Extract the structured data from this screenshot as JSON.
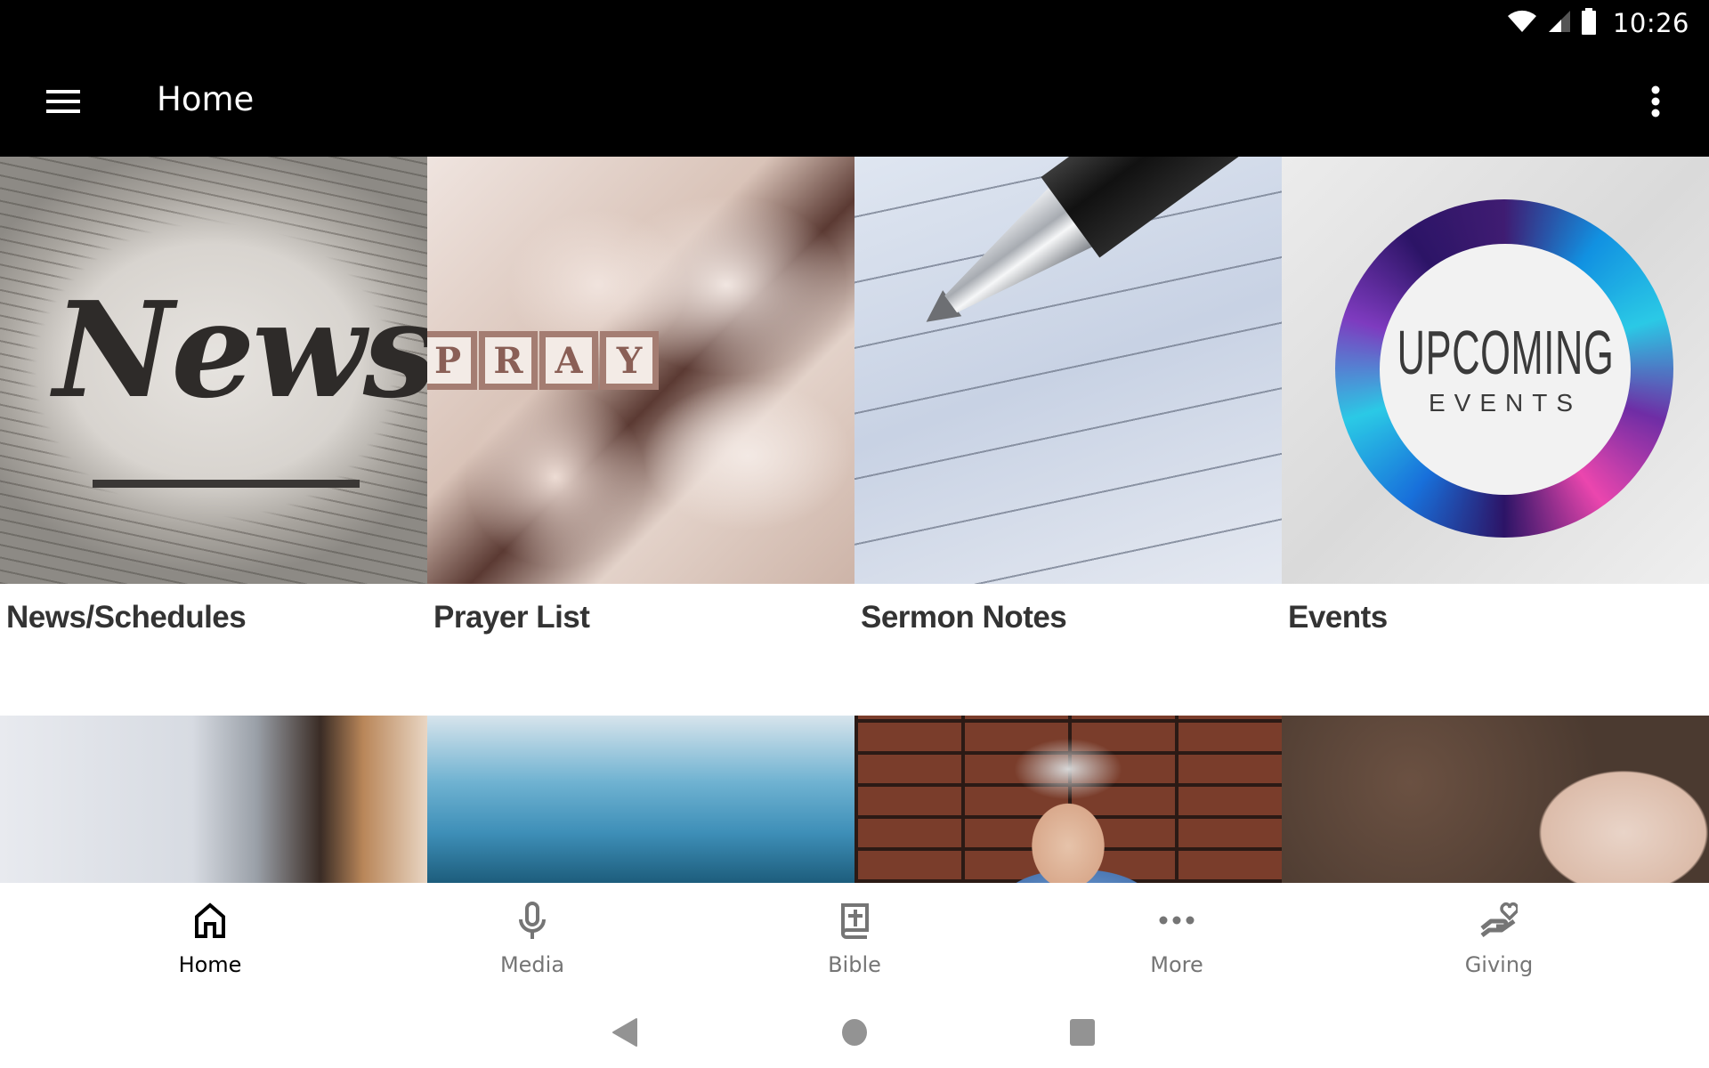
{
  "status_bar": {
    "time": "10:26",
    "icons": [
      "wifi-icon",
      "cell-signal-icon",
      "battery-icon"
    ]
  },
  "app_bar": {
    "title": "Home",
    "menu_icon": "hamburger-menu-icon",
    "overflow_icon": "more-vertical-icon"
  },
  "tiles": [
    {
      "label": "News/Schedules",
      "image_text": "News"
    },
    {
      "label": "Prayer List",
      "image_text": "PRAY"
    },
    {
      "label": "Sermon Notes"
    },
    {
      "label": "Events",
      "image_text_main": "UPCOMING",
      "image_text_sub": "EVENTS"
    },
    {
      "label": ""
    },
    {
      "label": ""
    },
    {
      "label": ""
    },
    {
      "label": ""
    }
  ],
  "bottom_nav": {
    "items": [
      {
        "label": "Home",
        "icon": "home-icon",
        "active": true
      },
      {
        "label": "Media",
        "icon": "microphone-icon",
        "active": false
      },
      {
        "label": "Bible",
        "icon": "bible-icon",
        "active": false
      },
      {
        "label": "More",
        "icon": "more-horizontal-icon",
        "active": false
      },
      {
        "label": "Giving",
        "icon": "giving-hand-heart-icon",
        "active": false
      }
    ],
    "active_color": "#000000",
    "inactive_color": "#757575"
  },
  "system_nav": {
    "buttons": [
      "back",
      "home",
      "recents"
    ],
    "color": "#939393"
  },
  "colors": {
    "app_bar": "#000000",
    "caption_text": "#333333",
    "background": "#ffffff"
  }
}
